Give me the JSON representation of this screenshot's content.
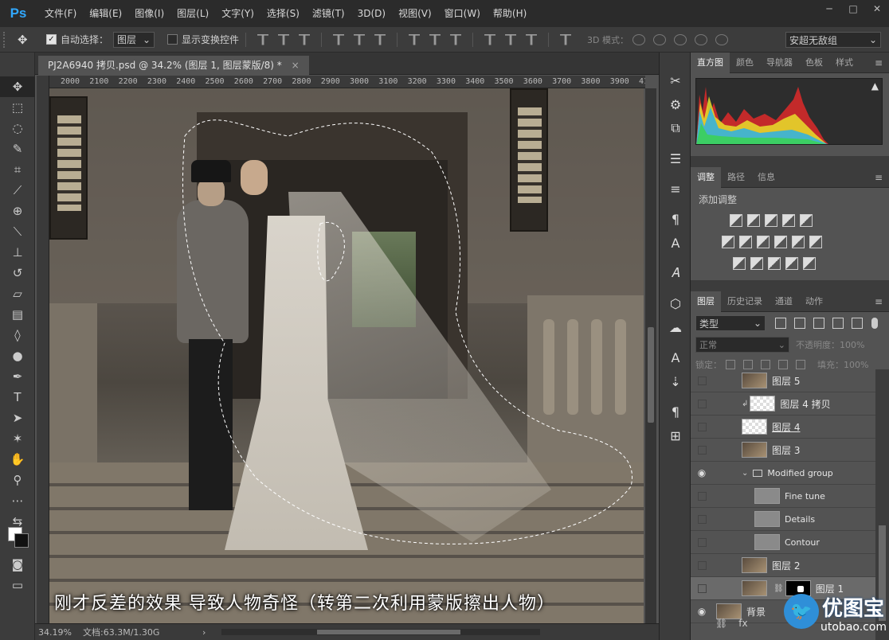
{
  "app": {
    "logo": "Ps",
    "menu": [
      "文件(F)",
      "编辑(E)",
      "图像(I)",
      "图层(L)",
      "文字(Y)",
      "选择(S)",
      "滤镜(T)",
      "3D(D)",
      "视图(V)",
      "窗口(W)",
      "帮助(H)"
    ],
    "window_controls": [
      "─",
      "□",
      "✕"
    ]
  },
  "options": {
    "auto_select_label": "自动选择：",
    "auto_select_checked": true,
    "auto_select_value": "图层",
    "show_transform_label": "显示变换控件",
    "mode_label": "3D 模式：",
    "font_select": "安超无敌组"
  },
  "document": {
    "tab_title": "PJ2A6940 拷贝.psd @ 34.2% (图层 1, 图层蒙版/8) *",
    "ruler_ticks": [
      "2000",
      "2100",
      "2200",
      "2300",
      "2400",
      "2500",
      "2600",
      "2700",
      "2800",
      "2900",
      "3000",
      "3100",
      "3200",
      "3300",
      "3400",
      "3500",
      "3600",
      "3700",
      "3800",
      "3900",
      "410"
    ],
    "caption": "刚才反差的效果 导致人物奇怪（转第二次利用蒙版擦出人物）"
  },
  "status": {
    "zoom": "34.19%",
    "doc_size": "文档:63.3M/1.30G"
  },
  "panels": {
    "top_tabs": [
      "直方图",
      "颜色",
      "导航器",
      "色板",
      "样式"
    ],
    "mid_tabs": [
      "调整",
      "路径",
      "信息"
    ],
    "adjust_title": "添加调整",
    "layer_tabs": [
      "图层",
      "历史记录",
      "通道",
      "动作"
    ],
    "filter_kind": "类型",
    "blend_mode": "正常",
    "opacity_label": "不透明度：",
    "opacity_value": "100%",
    "lock_label": "锁定：",
    "fill_label": "填充：",
    "fill_value": "100%"
  },
  "layers": [
    {
      "name": "图层 5",
      "visible": false,
      "thumb": "photo"
    },
    {
      "name": "图层 4 拷贝",
      "visible": false,
      "thumb": "trans",
      "clipped": true
    },
    {
      "name": "图层 4",
      "visible": false,
      "thumb": "trans",
      "underline": true
    },
    {
      "name": "图层 3",
      "visible": false,
      "thumb": "photo"
    },
    {
      "name": "Modified group",
      "visible": true,
      "folder": true
    },
    {
      "name": "Fine tune",
      "visible": false,
      "thumb": "adj",
      "indent": true
    },
    {
      "name": "Details",
      "visible": false,
      "thumb": "adj",
      "indent": true
    },
    {
      "name": "Contour",
      "visible": false,
      "thumb": "adj",
      "indent": true
    },
    {
      "name": "图层 2",
      "visible": false,
      "thumb": "photo"
    },
    {
      "name": "图层 1",
      "visible": false,
      "thumb": "photo",
      "mask": true,
      "selected": true
    },
    {
      "name": "背景",
      "visible": true,
      "thumb": "photo"
    }
  ],
  "watermark": {
    "main": "优图宝",
    "sub": "utobao.com"
  },
  "colors": {
    "accent": "#31a8ff",
    "menubar": "#2b2b2b",
    "panel": "#535353"
  }
}
